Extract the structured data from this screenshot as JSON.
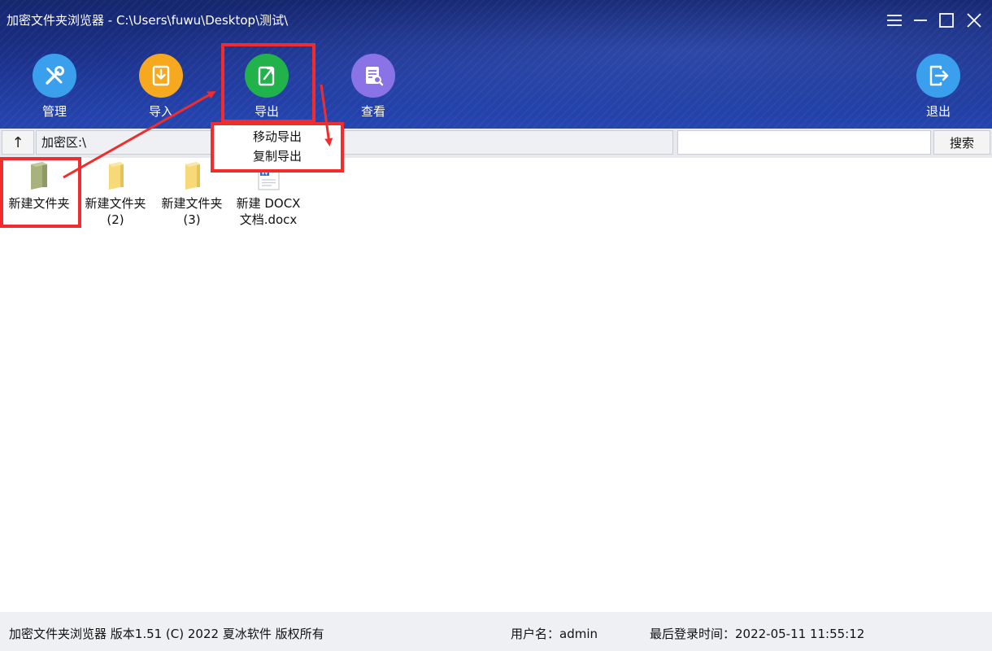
{
  "window": {
    "title": "加密文件夹浏览器 - C:\\Users\\fuwu\\Desktop\\测试\\"
  },
  "toolbar": {
    "manage_label": "管理",
    "import_label": "导入",
    "export_label": "导出",
    "view_label": "查看",
    "exit_label": "退出"
  },
  "addressbar": {
    "up_label": "↑",
    "path": "加密区:\\",
    "search_value": "",
    "search_label": "搜索"
  },
  "export_menu": {
    "items": [
      {
        "label": "移动导出"
      },
      {
        "label": "复制导出"
      }
    ]
  },
  "files": [
    {
      "line1": "新建文件夹",
      "line2": "",
      "icon": "folder-icon"
    },
    {
      "line1": "新建文件夹",
      "line2": "(2)",
      "icon": "folder-icon"
    },
    {
      "line1": "新建文件夹",
      "line2": "(3)",
      "icon": "folder-icon"
    },
    {
      "line1": "新建 DOCX",
      "line2": "文档.docx",
      "icon": "docx-file-icon"
    }
  ],
  "status": {
    "app_info": "加密文件夹浏览器 版本1.51 (C) 2022 夏冰软件 版权所有",
    "user": "用户名：admin",
    "last_login": "最后登录时间：2022-05-11 11:55:12"
  },
  "colors": {
    "header_bg": "#1a2f86",
    "manage": "#3aa0ee",
    "import": "#f6a81f",
    "export": "#21b24b",
    "view": "#8a73e6",
    "exit": "#3aa0ee",
    "annotation": "#f22c2c"
  }
}
